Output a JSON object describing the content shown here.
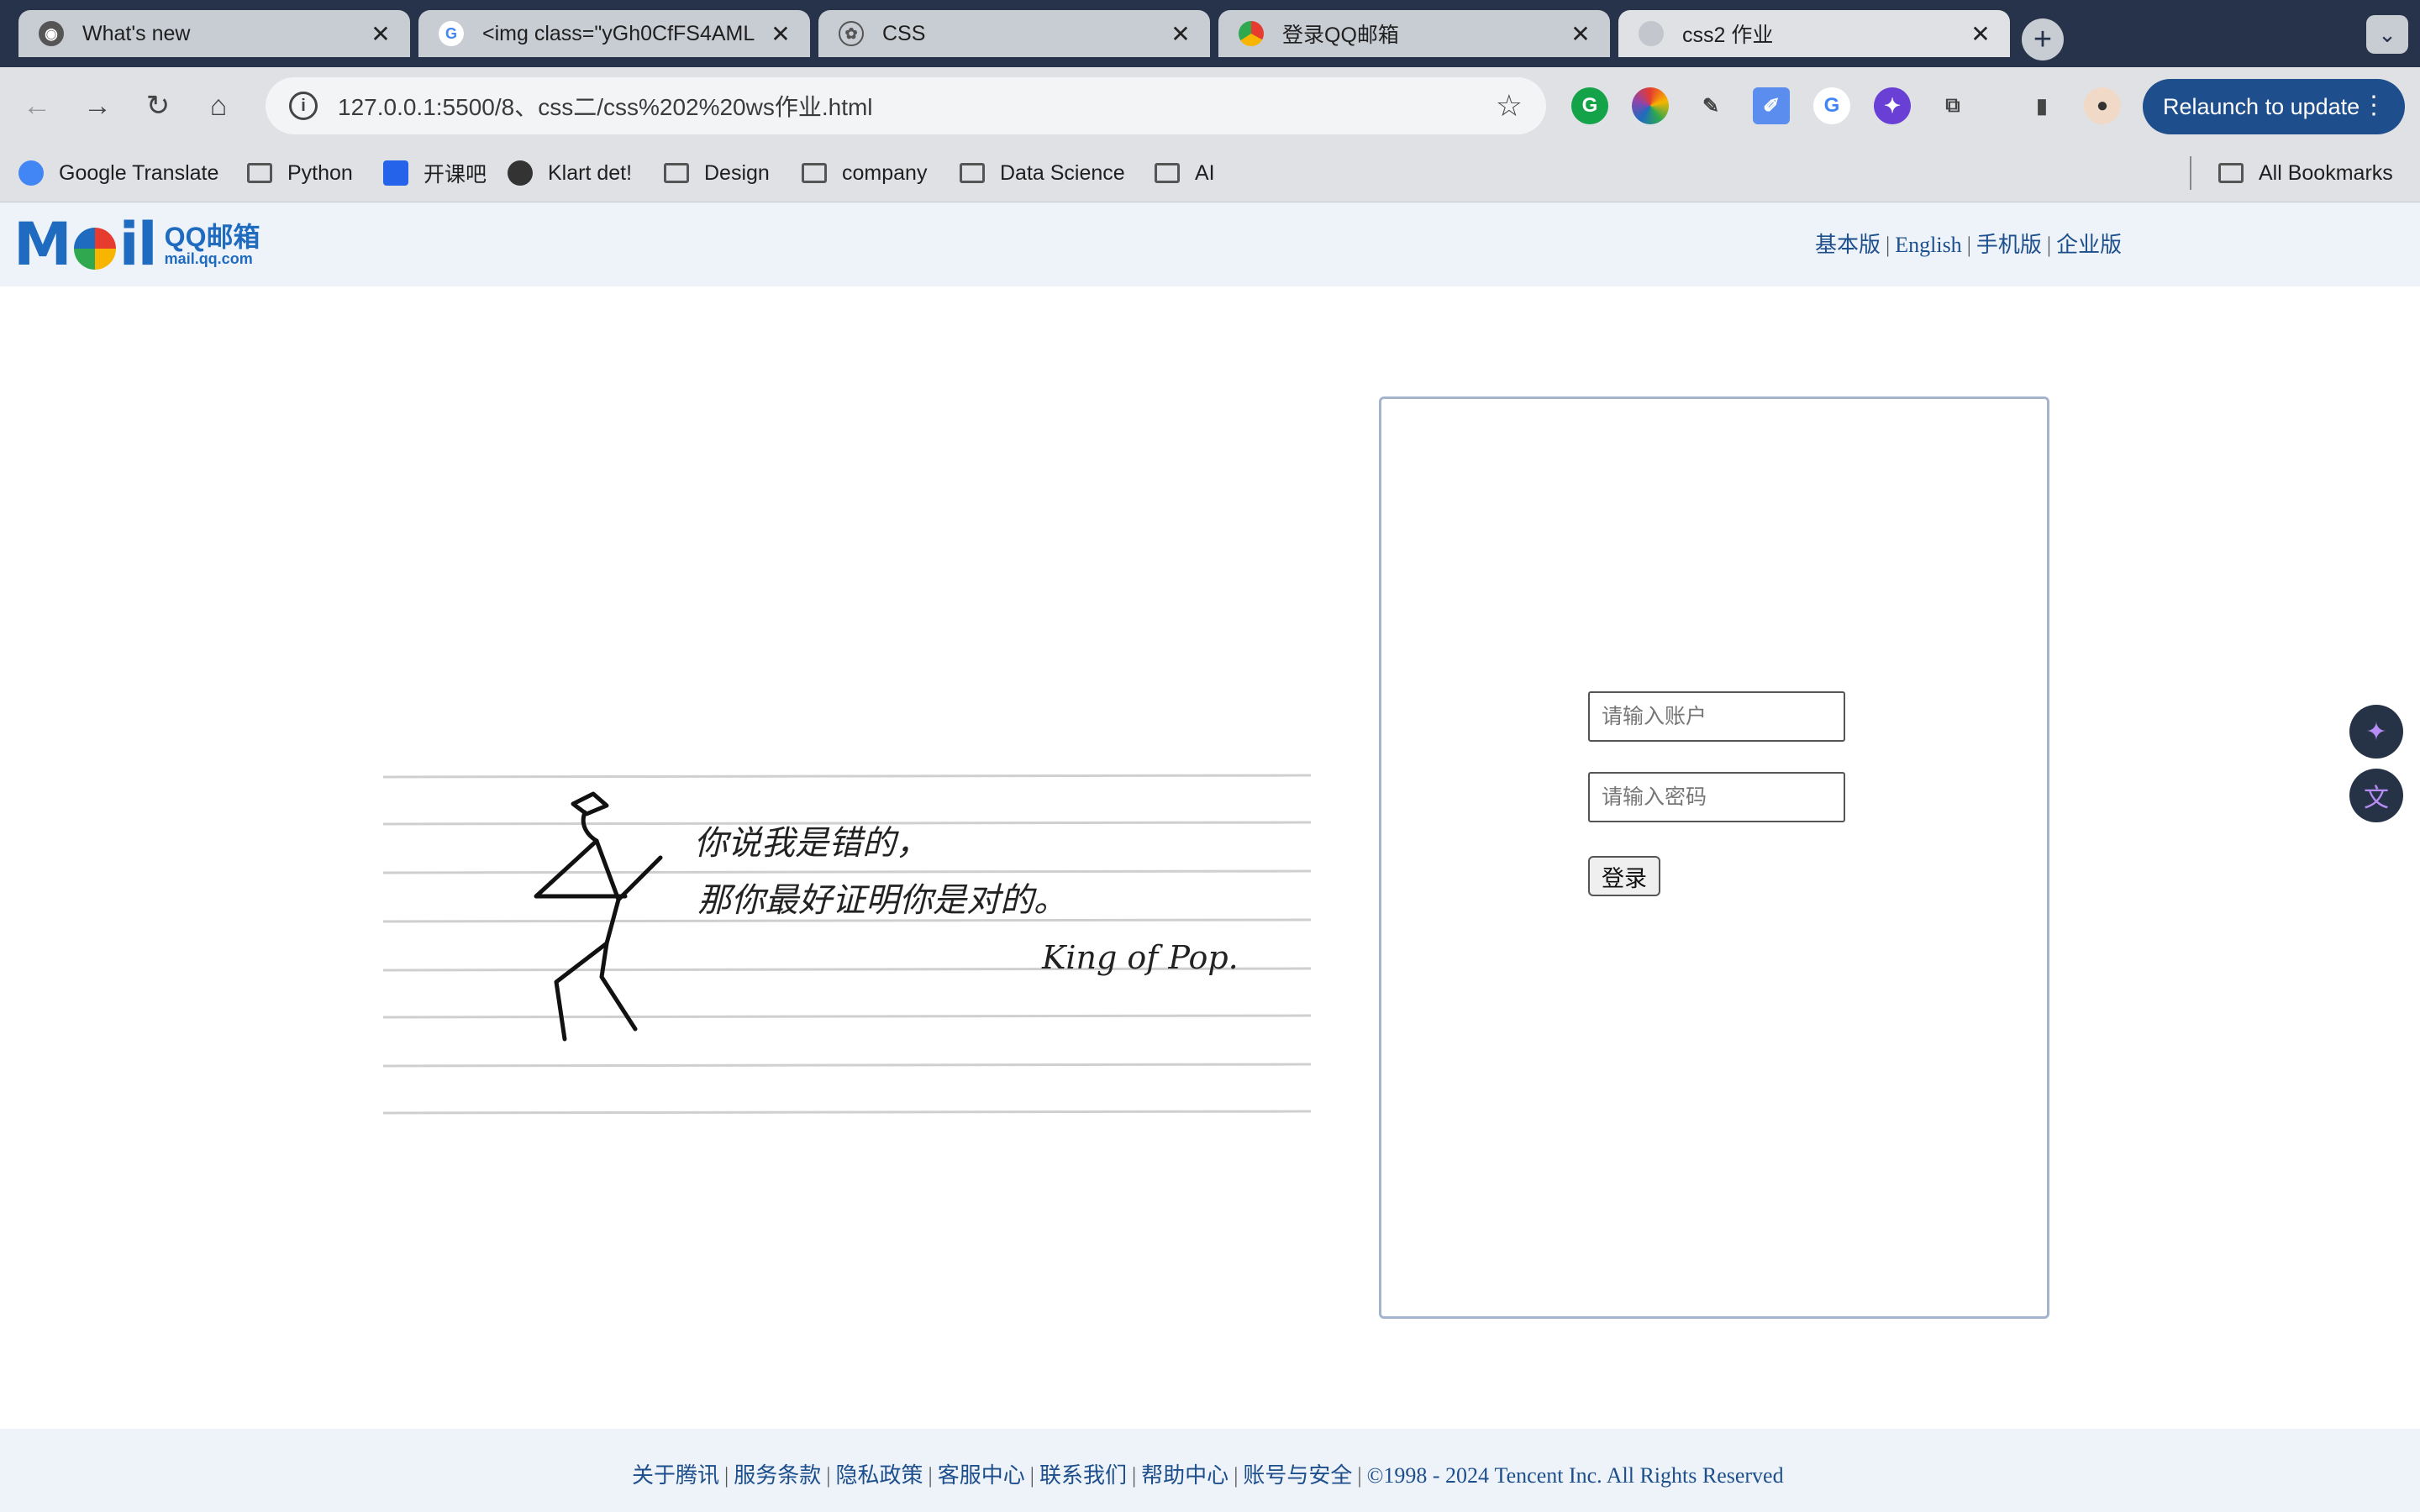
{
  "tabs": [
    {
      "title": "What's new",
      "icon": "chrome-icon"
    },
    {
      "title": "<img class=\"yGh0CfFS4AML",
      "icon": "google-icon"
    },
    {
      "title": "CSS",
      "icon": "openai-icon"
    },
    {
      "title": "登录QQ邮箱",
      "icon": "chrome-store-icon"
    },
    {
      "title": "css2 作业",
      "icon": "globe-icon"
    }
  ],
  "address_bar": {
    "url": "127.0.0.1:5500/8、css二/css%202%20ws作业.html"
  },
  "relaunch_label": "Relaunch to update",
  "bookmarks": [
    {
      "label": "Google Translate",
      "type": "site"
    },
    {
      "label": "Python",
      "type": "folder"
    },
    {
      "label": "开课吧",
      "type": "site"
    },
    {
      "label": "Klart det!",
      "type": "site"
    },
    {
      "label": "Design",
      "type": "folder"
    },
    {
      "label": "company",
      "type": "folder"
    },
    {
      "label": "Data Science",
      "type": "folder"
    },
    {
      "label": "AI",
      "type": "folder"
    }
  ],
  "all_bookmarks_label": "All Bookmarks",
  "header": {
    "logo_word": "Mail",
    "logo_cn": "QQ邮箱",
    "logo_domain": "mail.qq.com",
    "links": [
      "基本版",
      "English",
      "手机版",
      "企业版"
    ]
  },
  "banner": {
    "line1": "你说我是错的，",
    "line2": "那你最好证明你是对的。",
    "signature": "King of Pop."
  },
  "login": {
    "account_placeholder": "请输入账户",
    "password_placeholder": "请输入密码",
    "submit_label": "登录"
  },
  "footer": {
    "links": [
      "关于腾讯",
      "服务条款",
      "隐私政策",
      "客服中心",
      "联系我们",
      "帮助中心",
      "账号与安全"
    ],
    "copyright": "©1998 - 2024 Tencent Inc. All Rights Reserved"
  }
}
